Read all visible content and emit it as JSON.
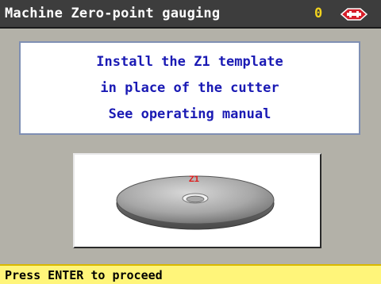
{
  "window": {
    "title": "Machine Zero-point gauging",
    "counter": "0",
    "logo_icon": "silca-logo-icon"
  },
  "message": {
    "lines": [
      "Install the Z1 template",
      "in place of the cutter",
      "See operating manual"
    ]
  },
  "illustration": {
    "icon": "z1-template-disc-icon",
    "label": "Z1"
  },
  "status": {
    "text": "Press ENTER to proceed"
  },
  "colors": {
    "titlebar": "#3d3d3d",
    "title_text": "#ffffff",
    "counter": "#f2d31e",
    "logo": "#d61f2a",
    "message_text": "#1a1ab4",
    "background": "#b3b1a8",
    "status_bg": "#fff57a",
    "disc_label": "#e01818"
  }
}
